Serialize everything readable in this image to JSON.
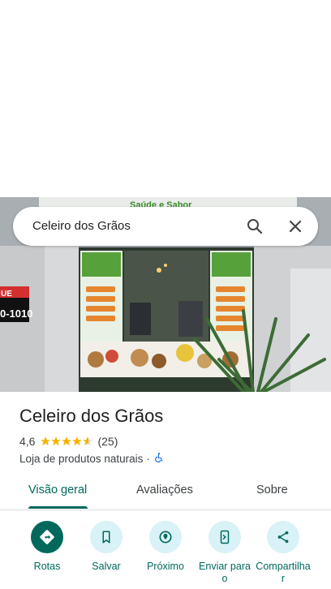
{
  "search": {
    "query": "Celeiro dos Grãos"
  },
  "photo": {
    "storefront_sign_left_line1": "UE",
    "storefront_sign_left_line2": "0-1010",
    "storefront_banner": "Saúde e Sabor"
  },
  "place": {
    "name": "Celeiro dos Grãos",
    "rating": "4,6",
    "rating_value": 4.6,
    "review_count": "(25)",
    "category": "Loja de produtos naturais",
    "separator": "·"
  },
  "tabs": [
    {
      "label": "Visão geral",
      "active": true
    },
    {
      "label": "Avaliações",
      "active": false
    },
    {
      "label": "Sobre",
      "active": false
    }
  ],
  "actions": [
    {
      "label": "Rotas",
      "icon": "directions-icon"
    },
    {
      "label": "Salvar",
      "icon": "bookmark-icon"
    },
    {
      "label": "Próximo",
      "icon": "nearby-icon"
    },
    {
      "label": "Enviar para o",
      "icon": "send-to-phone-icon"
    },
    {
      "label": "Compartilhar",
      "icon": "share-icon"
    }
  ],
  "colors": {
    "accent": "#00695c",
    "action_bg": "#d9f2f7",
    "star": "#f4b400",
    "accessible": "#1a73e8"
  }
}
